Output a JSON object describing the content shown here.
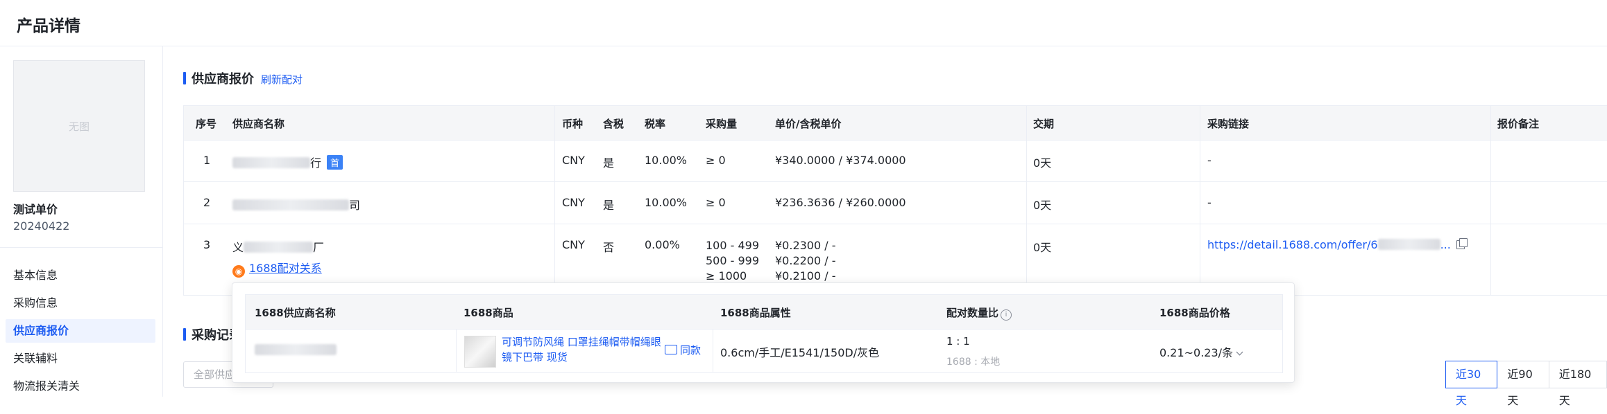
{
  "page": {
    "title": "产品详情"
  },
  "sidebar": {
    "thumb_placeholder": "无图",
    "product_name": "测试单价",
    "product_code": "20240422",
    "items": [
      {
        "label": "基本信息",
        "active": false
      },
      {
        "label": "采购信息",
        "active": false
      },
      {
        "label": "供应商报价",
        "active": true
      },
      {
        "label": "关联辅料",
        "active": false
      },
      {
        "label": "物流报关清关",
        "active": false
      }
    ]
  },
  "supplier_section": {
    "title": "供应商报价",
    "refresh_label": "刷新配对",
    "columns": [
      "序号",
      "供应商名称",
      "币种",
      "含税",
      "税率",
      "采购量",
      "单价/含税单价",
      "交期",
      "采购链接",
      "报价备注"
    ],
    "rows": [
      {
        "index": "1",
        "name_suffix": "行",
        "badge": "首",
        "currency": "CNY",
        "tax": "是",
        "rate": "10.00%",
        "qty": [
          "≥ 0"
        ],
        "price": [
          "¥340.0000 / ¥374.0000"
        ],
        "delivery": "0天",
        "link": "-",
        "note": ""
      },
      {
        "index": "2",
        "name_suffix": "司",
        "badge": "",
        "currency": "CNY",
        "tax": "是",
        "rate": "10.00%",
        "qty": [
          "≥ 0"
        ],
        "price": [
          "¥236.3636 / ¥260.0000"
        ],
        "delivery": "0天",
        "link": "-",
        "note": ""
      },
      {
        "index": "3",
        "name_prefix": "义",
        "name_suffix": "厂",
        "badge": "",
        "currency": "CNY",
        "tax": "否",
        "rate": "0.00%",
        "qty": [
          "100 - 499",
          "500 - 999",
          "≥ 1000"
        ],
        "price": [
          "¥0.2300 / -",
          "¥0.2200 / -",
          "¥0.2100 / -"
        ],
        "delivery": "0天",
        "link": "https://detail.1688.com/offer/6",
        "link_ellipsis": "...",
        "relation_link": "1688配对关系",
        "note": ""
      }
    ]
  },
  "popup": {
    "columns": [
      "1688供应商名称",
      "1688商品",
      "1688商品属性",
      "配对数量比",
      "1688商品价格"
    ],
    "row": {
      "product_title_line1": "可调节防风绳 口罩挂绳帽带帽绳眼",
      "product_title_line2": "镜下巴带 现货",
      "same_label": "同款",
      "attributes": "0.6cm/手工/E1541/150D/灰色",
      "ratio": "1 : 1",
      "ratio_sub": "1688 : 本地",
      "price": "0.21~0.23/条"
    }
  },
  "purchase_section": {
    "title": "采购记录",
    "filter_placeholder": "全部供应商",
    "ranges": [
      {
        "label": "近30天",
        "active": true
      },
      {
        "label": "近90天",
        "active": false
      },
      {
        "label": "近180天",
        "active": false
      }
    ]
  },
  "colors": {
    "accent": "#1d5cf2",
    "badge": "#3b82f6",
    "orange": "#ff7a1a"
  },
  "icons": [
    "info-icon",
    "copy-icon",
    "image-search-icon",
    "chevron-down-icon",
    "1688-logo-icon"
  ]
}
